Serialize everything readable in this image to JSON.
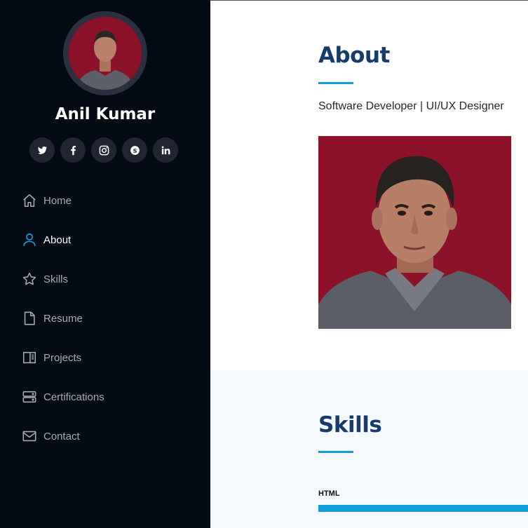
{
  "profile": {
    "name": "Anil Kumar"
  },
  "socials": [
    {
      "icon": "twitter-icon"
    },
    {
      "icon": "facebook-icon"
    },
    {
      "icon": "instagram-icon"
    },
    {
      "icon": "skype-icon"
    },
    {
      "icon": "linkedin-icon"
    }
  ],
  "nav": {
    "items": [
      {
        "label": "Home",
        "icon": "home-icon"
      },
      {
        "label": "About",
        "icon": "person-icon",
        "active": true
      },
      {
        "label": "Skills",
        "icon": "star-icon"
      },
      {
        "label": "Resume",
        "icon": "file-icon"
      },
      {
        "label": "Projects",
        "icon": "book-half-icon"
      },
      {
        "label": "Certifications",
        "icon": "server-icon"
      },
      {
        "label": "Contact",
        "icon": "envelope-icon"
      }
    ]
  },
  "about": {
    "title": "About",
    "subtitle": "Software Developer | UI/UX Designer"
  },
  "skills": {
    "title": "Skills",
    "items": [
      {
        "label": "HTML",
        "percent": 100
      }
    ]
  },
  "colors": {
    "sidebar_bg": "#040b14",
    "accent": "#149ddd",
    "heading": "#173b6c",
    "photo_bg": "#8b1228"
  }
}
